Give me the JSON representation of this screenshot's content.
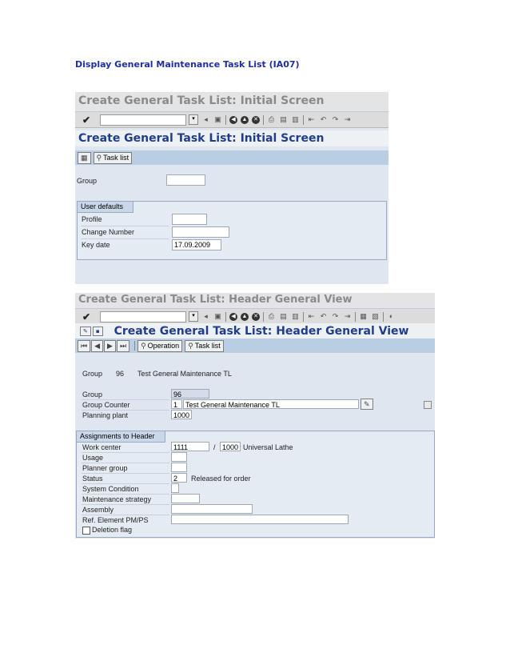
{
  "doc": {
    "title": "Display General Maintenance Task List (IA07)"
  },
  "screen1": {
    "window_title": "Create General Task List: Initial Screen",
    "screen_title": "Create General Task List: Initial Screen",
    "app_button": "Task list",
    "group_label": "Group",
    "group_value": "",
    "user_defaults": {
      "tab": "User defaults",
      "profile_label": "Profile",
      "profile_value": "",
      "change_number_label": "Change Number",
      "change_number_value": "",
      "key_date_label": "Key date",
      "key_date_value": "17.09.2009"
    }
  },
  "screen2": {
    "window_title": "Create General Task List: Header General View",
    "screen_title": "Create General Task List: Header General View",
    "app_buttons": {
      "operation": "Operation",
      "task_list": "Task list"
    },
    "header_line": {
      "group_label": "Group",
      "group_value": "96",
      "description": "Test General Maintenance TL"
    },
    "fields": {
      "group_label": "Group",
      "group_value": "96",
      "group_counter_label": "Group Counter",
      "group_counter_value": "1",
      "group_counter_text": "Test General Maintenance TL",
      "planning_plant_label": "Planning plant",
      "planning_plant_value": "1000"
    },
    "assignments": {
      "tab": "Assignments to Header",
      "work_center_label": "Work center",
      "work_center_value": "1111",
      "work_center_plant": "1000",
      "work_center_desc": "Universal Lathe",
      "usage_label": "Usage",
      "planner_group_label": "Planner group",
      "status_label": "Status",
      "status_value": "2",
      "status_text": "Released for order",
      "system_condition_label": "System Condition",
      "maintenance_strategy_label": "Maintenance strategy",
      "assembly_label": "Assembly",
      "ref_element_label": "Ref. Element PM/PS",
      "deletion_flag_label": "Deletion flag"
    }
  },
  "icons": [
    "check-icon",
    "save-icon",
    "back-icon",
    "exit-icon",
    "cancel-icon",
    "print-icon",
    "find-icon",
    "first-page-icon",
    "prev-page-icon",
    "next-page-icon",
    "last-page-icon",
    "copy-icon",
    "task-list-icon",
    "operation-icon",
    "edit-icon"
  ],
  "colors": {
    "doc_title": "#1f2f9e",
    "screen_title": "#1f3d8a",
    "app_toolbar": "#b9cde3",
    "workarea": "#dfe6ef"
  }
}
